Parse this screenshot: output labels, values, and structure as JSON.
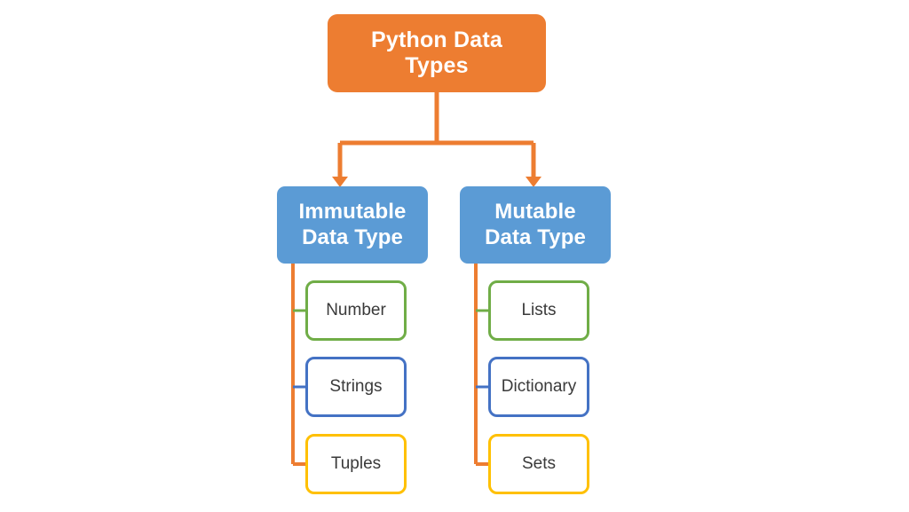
{
  "diagram": {
    "title": "Python Data Types hierarchy",
    "background_color": "#FFFFFF",
    "root": {
      "label": "Python Data Types",
      "line1": "Python Data",
      "line2": "Types",
      "fill_color": "#ED7D31",
      "text_color": "#FFFFFF"
    },
    "categories": [
      {
        "id": "immutable",
        "label": "Immutable Data Type",
        "line1": "Immutable",
        "line2": "Data Type",
        "fill_color": "#5B9BD5",
        "text_color": "#FFFFFF",
        "children": [
          {
            "label": "Number",
            "border_color": "#70AD47"
          },
          {
            "label": "Strings",
            "border_color": "#4472C4"
          },
          {
            "label": "Tuples",
            "border_color": "#FFC000"
          }
        ]
      },
      {
        "id": "mutable",
        "label": "Mutable Data Type",
        "line1": "Mutable",
        "line2": "Data Type",
        "fill_color": "#5B9BD5",
        "text_color": "#FFFFFF",
        "children": [
          {
            "label": "Lists",
            "border_color": "#70AD47"
          },
          {
            "label": "Dictionary",
            "border_color": "#4472C4"
          },
          {
            "label": "Sets",
            "border_color": "#FFC000"
          }
        ]
      }
    ],
    "connectors": {
      "trunk_color": "#ED7D31",
      "stub_colors": [
        "#70AD47",
        "#4472C4",
        "#ED7D31"
      ]
    }
  }
}
